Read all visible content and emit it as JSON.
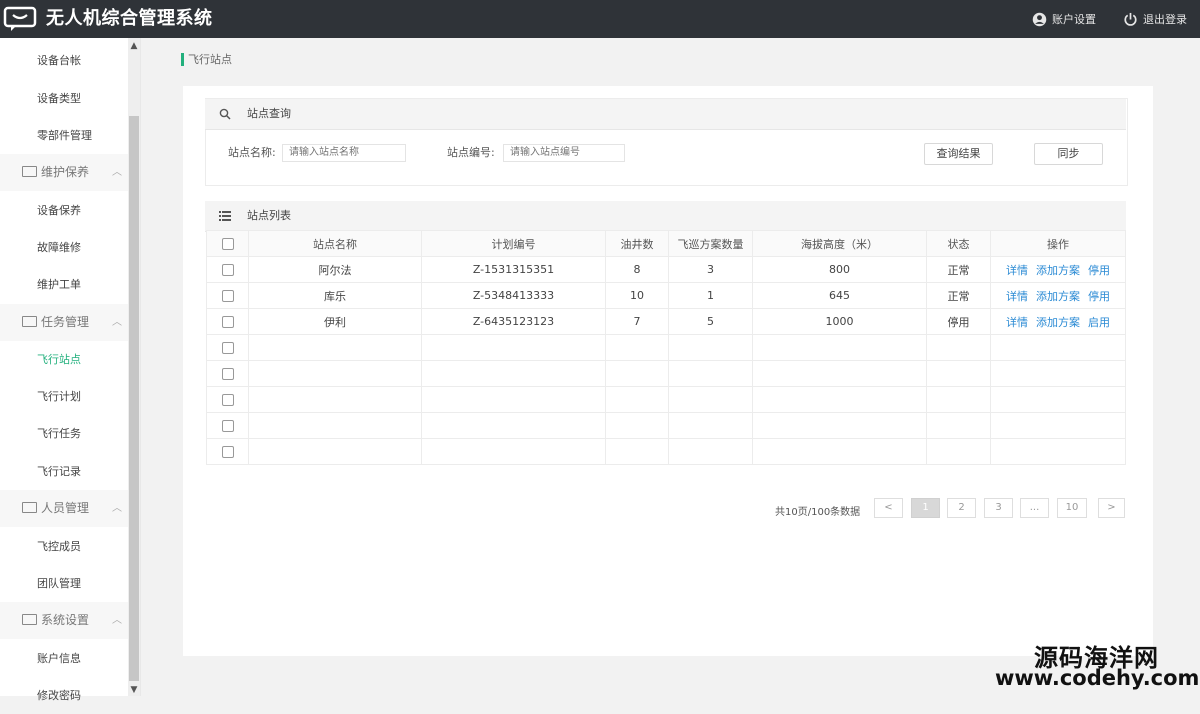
{
  "header": {
    "title": "无人机综合管理系统",
    "account_label": "账户设置",
    "logout_label": "退出登录"
  },
  "sidebar": {
    "items": [
      {
        "label": "设备台帐",
        "type": "item"
      },
      {
        "label": "设备类型",
        "type": "item"
      },
      {
        "label": "零部件管理",
        "type": "item"
      },
      {
        "label": "维护保养",
        "type": "group"
      },
      {
        "label": "设备保养",
        "type": "item"
      },
      {
        "label": "故障维修",
        "type": "item"
      },
      {
        "label": "维护工单",
        "type": "item"
      },
      {
        "label": "任务管理",
        "type": "group"
      },
      {
        "label": "飞行站点",
        "type": "item",
        "active": true
      },
      {
        "label": "飞行计划",
        "type": "item"
      },
      {
        "label": "飞行任务",
        "type": "item"
      },
      {
        "label": "飞行记录",
        "type": "item"
      },
      {
        "label": "人员管理",
        "type": "group"
      },
      {
        "label": "飞控成员",
        "type": "item"
      },
      {
        "label": "团队管理",
        "type": "item"
      },
      {
        "label": "系统设置",
        "type": "group"
      },
      {
        "label": "账户信息",
        "type": "item"
      },
      {
        "label": "修改密码",
        "type": "item"
      }
    ]
  },
  "breadcrumb": "飞行站点",
  "query": {
    "title": "站点查询",
    "name_label": "站点名称:",
    "name_placeholder": "请输入站点名称",
    "code_label": "站点编号:",
    "code_placeholder": "请输入站点编号",
    "search_button": "查询结果",
    "sync_button": "同步"
  },
  "list": {
    "title": "站点列表",
    "columns": [
      "站点名称",
      "计划编号",
      "油井数",
      "飞巡方案数量",
      "海拔高度（米）",
      "状态",
      "操作"
    ],
    "rows": [
      {
        "name": "阿尔法",
        "code": "Z-1531315351",
        "wells": "8",
        "plans": "3",
        "altitude": "800",
        "status": "正常",
        "ops": [
          "详情",
          "添加方案",
          "停用"
        ]
      },
      {
        "name": "库乐",
        "code": "Z-5348413333",
        "wells": "10",
        "plans": "1",
        "altitude": "645",
        "status": "正常",
        "ops": [
          "详情",
          "添加方案",
          "停用"
        ]
      },
      {
        "name": "伊利",
        "code": "Z-6435123123",
        "wells": "7",
        "plans": "5",
        "altitude": "1000",
        "status": "停用",
        "ops": [
          "详情",
          "添加方案",
          "启用"
        ]
      }
    ],
    "empty_rows": 5
  },
  "pagination": {
    "info": "共10页/100条数据",
    "prev": "<",
    "pages": [
      "1",
      "2",
      "3",
      "...",
      "10"
    ],
    "current": "1",
    "next": ">"
  },
  "watermark": {
    "line1": "源码海洋网",
    "line2": "www.codehy.com"
  },
  "colors": {
    "header_bg": "#2f3338",
    "accent": "#22b07d",
    "link": "#2a8ad4"
  }
}
